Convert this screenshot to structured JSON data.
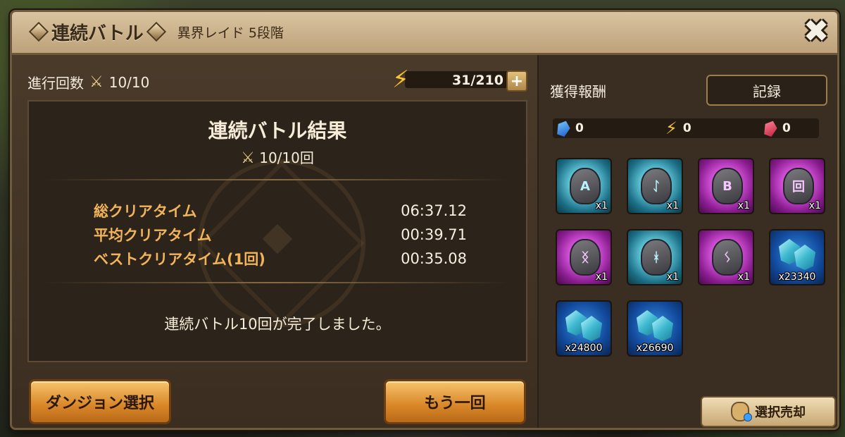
{
  "window": {
    "title": "連続バトル",
    "subtitle": "異界レイド 5段階",
    "close_glyph": "✖"
  },
  "progress": {
    "label": "進行回数",
    "value": "10/10"
  },
  "energy": {
    "value": "31/210",
    "plus": "+"
  },
  "result": {
    "title": "連続バトル結果",
    "count": "10/10回",
    "stats": [
      {
        "label": "総クリアタイム",
        "value": "06:37.12"
      },
      {
        "label": "平均クリアタイム",
        "value": "00:39.71"
      },
      {
        "label": "ベストクリアタイム(1回)",
        "value": "00:35.08"
      }
    ],
    "message": "連続バトル10回が完了しました。"
  },
  "buttons": {
    "dungeon_select": "ダンジョン選択",
    "retry": "もう一回",
    "record": "記録",
    "sell_selected": "選択売却"
  },
  "rewards": {
    "label": "獲得報酬",
    "currency": [
      {
        "icon": "crystal-icon",
        "value": "0"
      },
      {
        "icon": "energy-icon",
        "value": "0"
      },
      {
        "icon": "ruby-icon",
        "value": "0"
      }
    ],
    "items": [
      {
        "kind": "rune",
        "color": "teal",
        "glyph": "A",
        "qty": "x1"
      },
      {
        "kind": "rune",
        "color": "teal",
        "glyph": "ᛇ",
        "qty": "x1"
      },
      {
        "kind": "rune",
        "color": "pink",
        "glyph": "B",
        "qty": "x1"
      },
      {
        "kind": "rune",
        "color": "pink",
        "glyph": "回",
        "qty": "x1"
      },
      {
        "kind": "rune",
        "color": "pink",
        "glyph": "ᛝ",
        "qty": "x1"
      },
      {
        "kind": "rune",
        "color": "teal",
        "glyph": "ᚼ",
        "qty": "x1"
      },
      {
        "kind": "rune",
        "color": "pink",
        "glyph": "ᛊ",
        "qty": "x1"
      },
      {
        "kind": "crystal",
        "color": "crystal",
        "glyph": "",
        "qty": "x23340"
      },
      {
        "kind": "crystal",
        "color": "crystal",
        "glyph": "",
        "qty": "x24800"
      },
      {
        "kind": "crystal",
        "color": "crystal",
        "glyph": "",
        "qty": "x26690"
      }
    ]
  }
}
